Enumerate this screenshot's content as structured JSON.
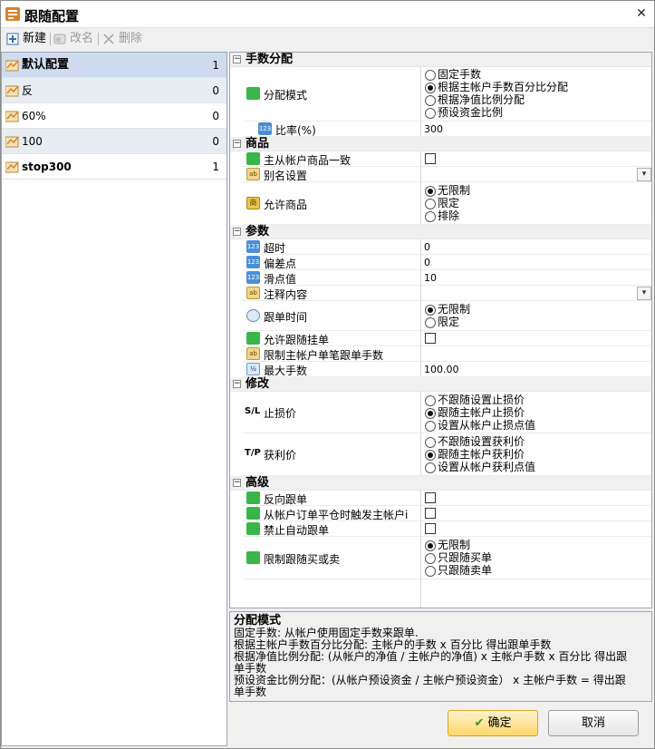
{
  "window": {
    "title": "跟随配置",
    "close_label": "✕"
  },
  "toolbar": {
    "new_label": "新建",
    "rename_label": "改名",
    "delete_label": "删除"
  },
  "profiles": [
    {
      "name": "默认配置",
      "count": "1"
    },
    {
      "name": "反",
      "count": "0"
    },
    {
      "name": "60%",
      "count": "0"
    },
    {
      "name": "100",
      "count": "0"
    },
    {
      "name": "stop300",
      "count": "1"
    }
  ],
  "grid": {
    "lot": {
      "title": "手数分配",
      "mode_label": "分配模式",
      "mode_options": [
        "固定手数",
        "根据主帐户手数百分比分配",
        "根据净值比例分配",
        "预设资金比例"
      ],
      "mode_selected": 1,
      "ratio_label": "比率(%)",
      "ratio_value": "300"
    },
    "symbols": {
      "title": "商品",
      "same_label": "主从帐户商品一致",
      "same_checked": false,
      "alias_label": "别名设置",
      "allow_label": "允许商品",
      "allow_options": [
        "无限制",
        "限定",
        "排除"
      ],
      "allow_selected": 0
    },
    "params": {
      "title": "参数",
      "timeout_label": "超时",
      "timeout_value": "0",
      "deviation_label": "偏差点",
      "deviation_value": "0",
      "slippage_label": "滑点值",
      "slippage_value": "10",
      "comment_label": "注释内容",
      "time_label": "跟单时间",
      "time_options": [
        "无限制",
        "限定"
      ],
      "time_selected": 0,
      "pending_label": "允许跟随挂单",
      "pending_checked": false,
      "limit_label": "限制主帐户单笔跟单手数",
      "maxlot_label": "最大手数",
      "maxlot_value": "100.00"
    },
    "modify": {
      "title": "修改",
      "sl_prefix": "S/L",
      "sl_label": "止损价",
      "sl_options": [
        "不跟随设置止损价",
        "跟随主帐户止损价",
        "设置从帐户止损点值"
      ],
      "sl_selected": 1,
      "tp_prefix": "T/P",
      "tp_label": "获利价",
      "tp_options": [
        "不跟随设置获利价",
        "跟随主帐户获利价",
        "设置从帐户获利点值"
      ],
      "tp_selected": 1
    },
    "advanced": {
      "title": "高级",
      "reverse_label": "反向跟单",
      "reverse_checked": false,
      "slave_close_label": "从帐户订单平仓时触发主帐户i",
      "slave_close_checked": false,
      "disable_auto_label": "禁止自动跟单",
      "disable_auto_checked": false,
      "restrict_label": "限制跟随买或卖",
      "restrict_options": [
        "无限制",
        "只跟随买单",
        "只跟随卖单"
      ],
      "restrict_selected": 0
    }
  },
  "description": {
    "title": "分配模式",
    "lines": [
      "固定手数: 从帐户使用固定手数来跟单.",
      "根据主帐户手数百分比分配: 主帐户的手数 x 百分比 得出跟单手数",
      "根据净值比例分配: (从帐户的净值 / 主帐户的净值) x 主帐户手数 x 百分比 得出跟",
      "单手数",
      "预设资金比例分配：(从帐户预设资金 / 主帐户预设资金） x 主帐户手数 = 得出跟",
      "单手数"
    ]
  },
  "buttons": {
    "ok_label": "确定",
    "cancel_label": "取消"
  },
  "colors": {
    "selected_row": "#cfdcf0",
    "ok_button": "#ffd86a",
    "category_bg": "#f0f0f0"
  }
}
